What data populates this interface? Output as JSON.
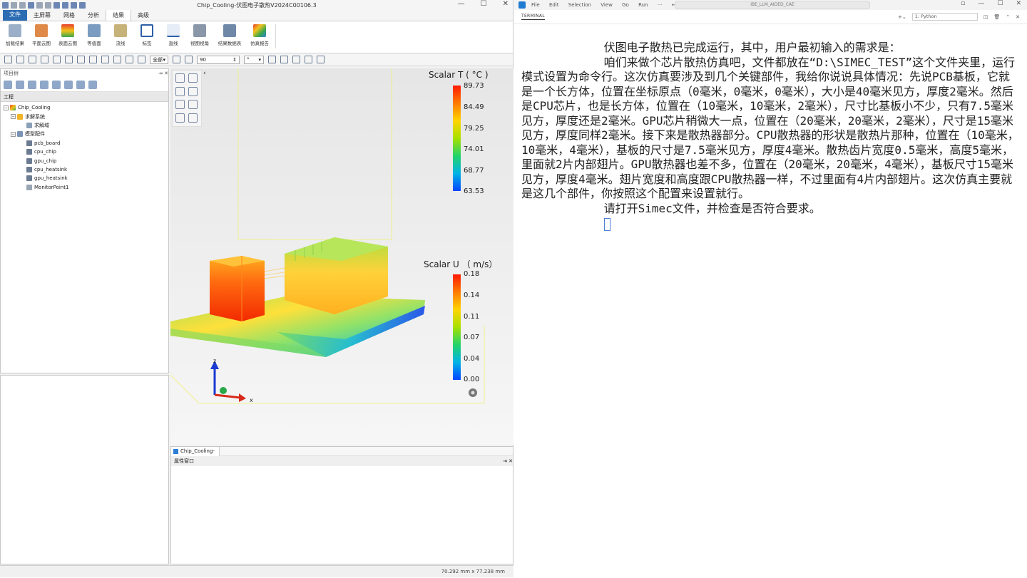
{
  "left_app": {
    "window_title": "Chip_Cooling-伏图电子散热V2024C00106.3",
    "ribbon_tabs": [
      "文件",
      "主屏幕",
      "网格",
      "分析",
      "结果",
      "高级"
    ],
    "ribbon_buttons": [
      "加载结果",
      "平面云图",
      "表面云图",
      "等值面",
      "流线",
      "标签",
      "直线",
      "视图视角",
      "结果数据表",
      "仿真报告"
    ],
    "toolbar": {
      "view_select": "全部",
      "zoom_value": "90",
      "unit_value": "°"
    },
    "project_panel_title": "项目树",
    "tree_header": "工程",
    "tree": [
      {
        "label": "Chip_Cooling",
        "level": 0
      },
      {
        "label": "求解系统",
        "level": 1
      },
      {
        "label": "求解域",
        "level": 2
      },
      {
        "label": "模型配件",
        "level": 1
      },
      {
        "label": "pcb_board",
        "level": 2
      },
      {
        "label": "cpu_chip",
        "level": 2
      },
      {
        "label": "gpu_chip",
        "level": 2
      },
      {
        "label": "cpu_heatsink",
        "level": 2
      },
      {
        "label": "gpu_heatsink",
        "level": 2
      },
      {
        "label": "MonitorPoint1",
        "level": 2
      }
    ],
    "legend_t": {
      "title": "Scalar T ( °C )",
      "ticks": [
        "89.73",
        "84.49",
        "79.25",
        "74.01",
        "68.77",
        "63.53"
      ]
    },
    "legend_u": {
      "title": "Scalar U （ m/s）",
      "ticks": [
        "0.18",
        "0.14",
        "0.11",
        "0.07",
        "0.04",
        "0.00"
      ]
    },
    "axes": {
      "z": "z",
      "x": "x"
    },
    "doc_tab": "Chip_Cooling-",
    "property_panel_title": "属性窗口",
    "status_text": "70.292 mm x 77.238 mm"
  },
  "vscode": {
    "menu": [
      "File",
      "Edit",
      "Selection",
      "View",
      "Go",
      "Run",
      "···"
    ],
    "search": "IBE_LLM_AIDED_CAE",
    "terminal_tab": "TERMINAL",
    "terminal_select": "1: Python",
    "terminal_text": "            伏图电子散热已完成运行，其中，用户最初输入的需求是：\n            咱们来做个芯片散热仿真吧，文件都放在“D:\\SIMEC_TEST”这个文件夹里，运行模式设置为命令行。这次仿真要涉及到几个关键部件，我给你说说具体情况：先说PCB基板，它就是一个长方体，位置在坐标原点（0毫米，0毫米，0毫米），大小是40毫米见方，厚度2毫米。然后是CPU芯片，也是长方体，位置在（10毫米，10毫米，2毫米），尺寸比基板小不少，只有7.5毫米见方，厚度还是2毫米。GPU芯片稍微大一点，位置在（20毫米，20毫米，2毫米），尺寸是15毫米见方，厚度同样2毫米。接下来是散热器部分。CPU散热器的形状是散热片那种，位置在（10毫米，10毫米，4毫米），基板的尺寸是7.5毫米见方，厚度4毫米。散热齿片宽度0.5毫米，高度5毫米，里面就2片内部翅片。GPU散热器也差不多，位置在（20毫米，20毫米，4毫米），基板尺寸15毫米见方，厚度4毫米。翅片宽度和高度跟CPU散热器一样，不过里面有4片内部翅片。这次仿真主要就是这几个部件，你按照这个配置来设置就行。\n            请打开Simec文件，并检查是否符合要求。\n            "
  }
}
